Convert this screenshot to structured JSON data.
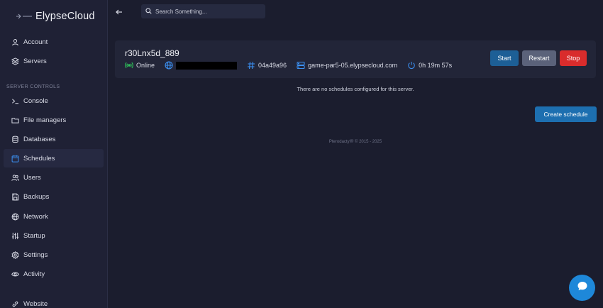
{
  "brand": {
    "name": "ElypseCloud"
  },
  "nav_top": [
    {
      "label": "Account",
      "icon": "user-icon"
    },
    {
      "label": "Servers",
      "icon": "layers-icon"
    }
  ],
  "section_label": "SERVER CONTROLS",
  "nav_server": [
    {
      "label": "Console",
      "icon": "terminal-icon"
    },
    {
      "label": "File managers",
      "icon": "folder-icon"
    },
    {
      "label": "Databases",
      "icon": "database-icon"
    },
    {
      "label": "Schedules",
      "icon": "calendar-icon",
      "active": true
    },
    {
      "label": "Users",
      "icon": "users-icon"
    },
    {
      "label": "Backups",
      "icon": "backup-icon"
    },
    {
      "label": "Network",
      "icon": "globe-icon"
    },
    {
      "label": "Startup",
      "icon": "sliders-icon"
    },
    {
      "label": "Settings",
      "icon": "gear-icon"
    },
    {
      "label": "Activity",
      "icon": "eye-icon"
    }
  ],
  "nav_bottom": [
    {
      "label": "Website",
      "icon": "link-icon"
    }
  ],
  "search": {
    "placeholder": "Search Something..."
  },
  "server": {
    "name": "r30Lnx5d_889",
    "status": "Online",
    "id": "04a49a96",
    "node": "game-par5-05.elypsecloud.com",
    "uptime": "0h 19m 57s"
  },
  "actions": {
    "start": "Start",
    "restart": "Restart",
    "stop": "Stop"
  },
  "schedules": {
    "empty_message": "There are no schedules configured for this server.",
    "create_label": "Create schedule"
  },
  "footer": "Pterodactyl® © 2015 - 2025",
  "colors": {
    "accent": "#1d6fb0",
    "online": "#2fbf5a",
    "stop": "#d92c2c",
    "background": "#1b1d2e"
  }
}
